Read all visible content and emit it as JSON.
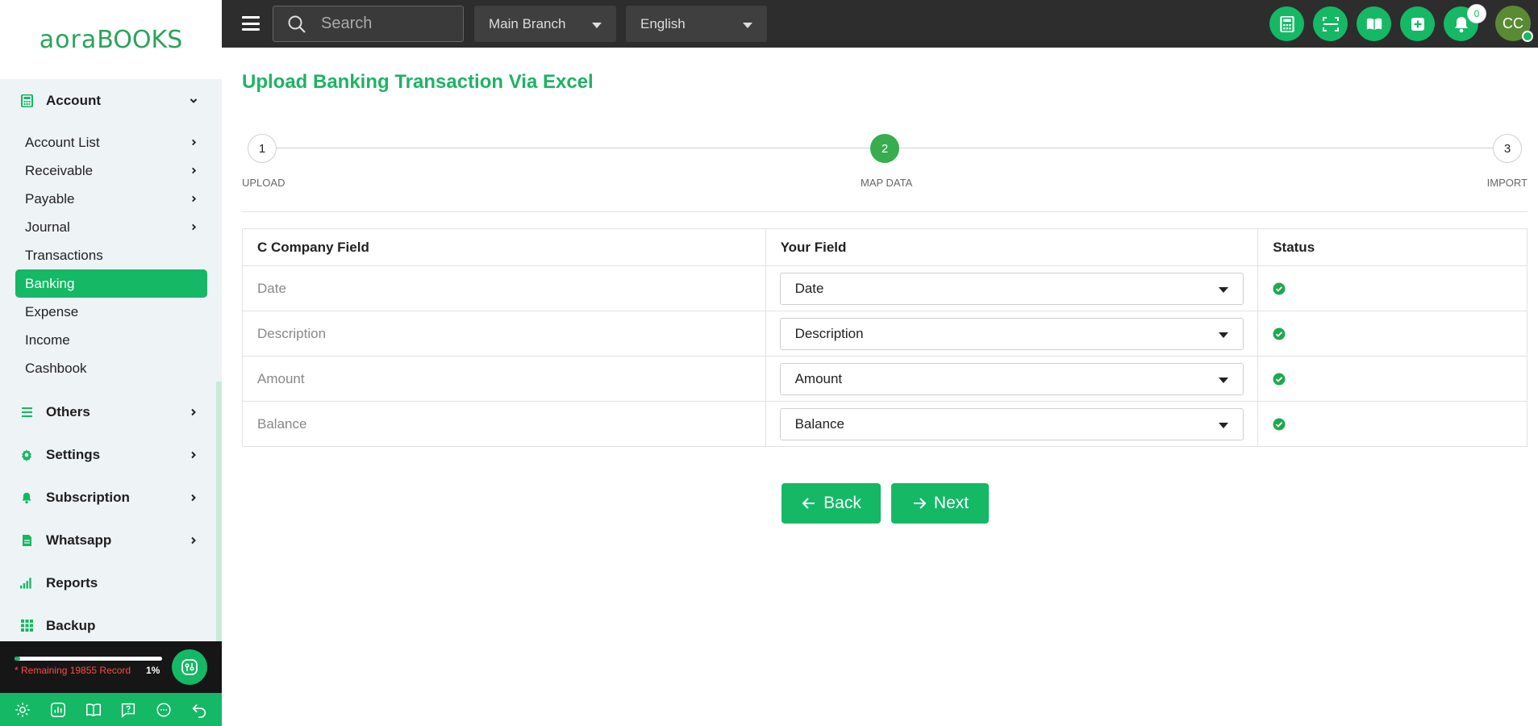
{
  "brand": {
    "logo_left": "aora",
    "logo_right": "BOOKS",
    "accent": "#15b865",
    "title_color": "#1db365"
  },
  "sidebar": {
    "account_group": {
      "label": "Account",
      "items": [
        {
          "label": "Account List",
          "has_arrow": true
        },
        {
          "label": "Receivable",
          "has_arrow": true
        },
        {
          "label": "Payable",
          "has_arrow": true
        },
        {
          "label": "Journal",
          "has_arrow": true
        },
        {
          "label": "Transactions",
          "has_arrow": false
        },
        {
          "label": "Banking",
          "has_arrow": false,
          "active": true
        },
        {
          "label": "Expense",
          "has_arrow": false
        },
        {
          "label": "Income",
          "has_arrow": false
        },
        {
          "label": "Cashbook",
          "has_arrow": false
        }
      ]
    },
    "groups": [
      {
        "label": "Others",
        "icon": "list-icon"
      },
      {
        "label": "Settings",
        "icon": "gear-icon"
      },
      {
        "label": "Subscription",
        "icon": "bell-icon"
      },
      {
        "label": "Whatsapp",
        "icon": "document-icon"
      },
      {
        "label": "Reports",
        "icon": "signal-bars-icon"
      },
      {
        "label": "Backup",
        "icon": "grid-icon"
      }
    ],
    "records": {
      "remaining_text": "* Remaining 19855 Record",
      "percent_text": "1%",
      "progress": 0.01
    }
  },
  "topbar": {
    "search_placeholder": "Search",
    "branch": "Main Branch",
    "language": "English",
    "notification_count": "0",
    "avatar_initials": "CC"
  },
  "main": {
    "title": "Upload Banking Transaction Via Excel",
    "steps": [
      {
        "number": "1",
        "label": "UPLOAD"
      },
      {
        "number": "2",
        "label": "MAP DATA",
        "active": true
      },
      {
        "number": "3",
        "label": "IMPORT"
      }
    ],
    "table": {
      "headers": [
        "C Company Field",
        "Your Field",
        "Status"
      ],
      "rows": [
        {
          "company_field": "Date",
          "your_field": "Date",
          "status": "ok"
        },
        {
          "company_field": "Description",
          "your_field": "Description",
          "status": "ok"
        },
        {
          "company_field": "Amount",
          "your_field": "Amount",
          "status": "ok"
        },
        {
          "company_field": "Balance",
          "your_field": "Balance",
          "status": "ok"
        }
      ]
    },
    "buttons": {
      "back": "Back",
      "next": "Next"
    }
  }
}
